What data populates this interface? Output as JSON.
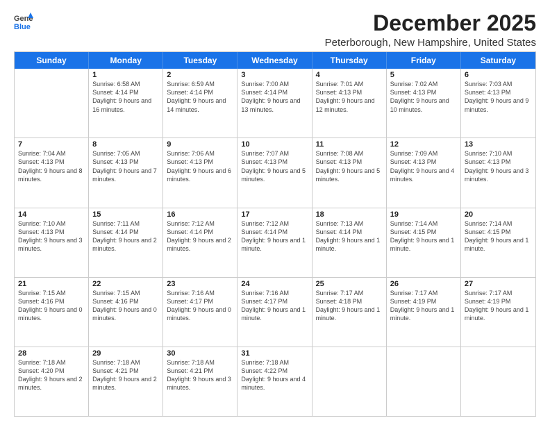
{
  "logo": {
    "general": "General",
    "blue": "Blue"
  },
  "title": "December 2025",
  "subtitle": "Peterborough, New Hampshire, United States",
  "days": [
    "Sunday",
    "Monday",
    "Tuesday",
    "Wednesday",
    "Thursday",
    "Friday",
    "Saturday"
  ],
  "weeks": [
    [
      {
        "day": "",
        "sunrise": "",
        "sunset": "",
        "daylight": ""
      },
      {
        "day": "1",
        "sunrise": "Sunrise: 6:58 AM",
        "sunset": "Sunset: 4:14 PM",
        "daylight": "Daylight: 9 hours and 16 minutes."
      },
      {
        "day": "2",
        "sunrise": "Sunrise: 6:59 AM",
        "sunset": "Sunset: 4:14 PM",
        "daylight": "Daylight: 9 hours and 14 minutes."
      },
      {
        "day": "3",
        "sunrise": "Sunrise: 7:00 AM",
        "sunset": "Sunset: 4:14 PM",
        "daylight": "Daylight: 9 hours and 13 minutes."
      },
      {
        "day": "4",
        "sunrise": "Sunrise: 7:01 AM",
        "sunset": "Sunset: 4:13 PM",
        "daylight": "Daylight: 9 hours and 12 minutes."
      },
      {
        "day": "5",
        "sunrise": "Sunrise: 7:02 AM",
        "sunset": "Sunset: 4:13 PM",
        "daylight": "Daylight: 9 hours and 10 minutes."
      },
      {
        "day": "6",
        "sunrise": "Sunrise: 7:03 AM",
        "sunset": "Sunset: 4:13 PM",
        "daylight": "Daylight: 9 hours and 9 minutes."
      }
    ],
    [
      {
        "day": "7",
        "sunrise": "Sunrise: 7:04 AM",
        "sunset": "Sunset: 4:13 PM",
        "daylight": "Daylight: 9 hours and 8 minutes."
      },
      {
        "day": "8",
        "sunrise": "Sunrise: 7:05 AM",
        "sunset": "Sunset: 4:13 PM",
        "daylight": "Daylight: 9 hours and 7 minutes."
      },
      {
        "day": "9",
        "sunrise": "Sunrise: 7:06 AM",
        "sunset": "Sunset: 4:13 PM",
        "daylight": "Daylight: 9 hours and 6 minutes."
      },
      {
        "day": "10",
        "sunrise": "Sunrise: 7:07 AM",
        "sunset": "Sunset: 4:13 PM",
        "daylight": "Daylight: 9 hours and 5 minutes."
      },
      {
        "day": "11",
        "sunrise": "Sunrise: 7:08 AM",
        "sunset": "Sunset: 4:13 PM",
        "daylight": "Daylight: 9 hours and 5 minutes."
      },
      {
        "day": "12",
        "sunrise": "Sunrise: 7:09 AM",
        "sunset": "Sunset: 4:13 PM",
        "daylight": "Daylight: 9 hours and 4 minutes."
      },
      {
        "day": "13",
        "sunrise": "Sunrise: 7:10 AM",
        "sunset": "Sunset: 4:13 PM",
        "daylight": "Daylight: 9 hours and 3 minutes."
      }
    ],
    [
      {
        "day": "14",
        "sunrise": "Sunrise: 7:10 AM",
        "sunset": "Sunset: 4:13 PM",
        "daylight": "Daylight: 9 hours and 3 minutes."
      },
      {
        "day": "15",
        "sunrise": "Sunrise: 7:11 AM",
        "sunset": "Sunset: 4:14 PM",
        "daylight": "Daylight: 9 hours and 2 minutes."
      },
      {
        "day": "16",
        "sunrise": "Sunrise: 7:12 AM",
        "sunset": "Sunset: 4:14 PM",
        "daylight": "Daylight: 9 hours and 2 minutes."
      },
      {
        "day": "17",
        "sunrise": "Sunrise: 7:12 AM",
        "sunset": "Sunset: 4:14 PM",
        "daylight": "Daylight: 9 hours and 1 minute."
      },
      {
        "day": "18",
        "sunrise": "Sunrise: 7:13 AM",
        "sunset": "Sunset: 4:14 PM",
        "daylight": "Daylight: 9 hours and 1 minute."
      },
      {
        "day": "19",
        "sunrise": "Sunrise: 7:14 AM",
        "sunset": "Sunset: 4:15 PM",
        "daylight": "Daylight: 9 hours and 1 minute."
      },
      {
        "day": "20",
        "sunrise": "Sunrise: 7:14 AM",
        "sunset": "Sunset: 4:15 PM",
        "daylight": "Daylight: 9 hours and 1 minute."
      }
    ],
    [
      {
        "day": "21",
        "sunrise": "Sunrise: 7:15 AM",
        "sunset": "Sunset: 4:16 PM",
        "daylight": "Daylight: 9 hours and 0 minutes."
      },
      {
        "day": "22",
        "sunrise": "Sunrise: 7:15 AM",
        "sunset": "Sunset: 4:16 PM",
        "daylight": "Daylight: 9 hours and 0 minutes."
      },
      {
        "day": "23",
        "sunrise": "Sunrise: 7:16 AM",
        "sunset": "Sunset: 4:17 PM",
        "daylight": "Daylight: 9 hours and 0 minutes."
      },
      {
        "day": "24",
        "sunrise": "Sunrise: 7:16 AM",
        "sunset": "Sunset: 4:17 PM",
        "daylight": "Daylight: 9 hours and 1 minute."
      },
      {
        "day": "25",
        "sunrise": "Sunrise: 7:17 AM",
        "sunset": "Sunset: 4:18 PM",
        "daylight": "Daylight: 9 hours and 1 minute."
      },
      {
        "day": "26",
        "sunrise": "Sunrise: 7:17 AM",
        "sunset": "Sunset: 4:19 PM",
        "daylight": "Daylight: 9 hours and 1 minute."
      },
      {
        "day": "27",
        "sunrise": "Sunrise: 7:17 AM",
        "sunset": "Sunset: 4:19 PM",
        "daylight": "Daylight: 9 hours and 1 minute."
      }
    ],
    [
      {
        "day": "28",
        "sunrise": "Sunrise: 7:18 AM",
        "sunset": "Sunset: 4:20 PM",
        "daylight": "Daylight: 9 hours and 2 minutes."
      },
      {
        "day": "29",
        "sunrise": "Sunrise: 7:18 AM",
        "sunset": "Sunset: 4:21 PM",
        "daylight": "Daylight: 9 hours and 2 minutes."
      },
      {
        "day": "30",
        "sunrise": "Sunrise: 7:18 AM",
        "sunset": "Sunset: 4:21 PM",
        "daylight": "Daylight: 9 hours and 3 minutes."
      },
      {
        "day": "31",
        "sunrise": "Sunrise: 7:18 AM",
        "sunset": "Sunset: 4:22 PM",
        "daylight": "Daylight: 9 hours and 4 minutes."
      },
      {
        "day": "",
        "sunrise": "",
        "sunset": "",
        "daylight": ""
      },
      {
        "day": "",
        "sunrise": "",
        "sunset": "",
        "daylight": ""
      },
      {
        "day": "",
        "sunrise": "",
        "sunset": "",
        "daylight": ""
      }
    ]
  ]
}
